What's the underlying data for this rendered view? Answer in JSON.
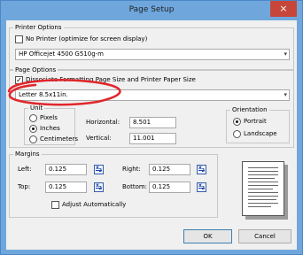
{
  "window": {
    "title": "Page Setup",
    "close_glyph": "×"
  },
  "printer_options": {
    "title": "Printer Options",
    "no_printer_label": "No Printer (optimize for screen display)",
    "no_printer_checked": false,
    "printer_selected": "HP Officejet 4500 G510g-m"
  },
  "page_options": {
    "title": "Page Options",
    "dissociate_label": "Dissociate Formatting Page Size and Printer Paper Size",
    "dissociate_checked": true,
    "page_size_selected": "Letter 8.5x11in."
  },
  "unit": {
    "title": "Unit",
    "options": [
      "Pixels",
      "Inches",
      "Centimeters"
    ],
    "selected": "Inches"
  },
  "size": {
    "horizontal_label": "Horizontal:",
    "horizontal_value": "8.501",
    "vertical_label": "Vertical:",
    "vertical_value": "11.001"
  },
  "orientation": {
    "title": "Orientation",
    "options": [
      "Portrait",
      "Landscape"
    ],
    "selected": "Portrait"
  },
  "margins": {
    "title": "Margins",
    "left_label": "Left:",
    "left_value": "0.125",
    "right_label": "Right:",
    "right_value": "0.125",
    "top_label": "Top:",
    "top_value": "0.125",
    "bottom_label": "Bottom:",
    "bottom_value": "0.125",
    "calc_x": "x",
    "calc_n": "2",
    "adjust_label": "Adjust Automatically",
    "adjust_checked": false
  },
  "buttons": {
    "ok": "OK",
    "cancel": "Cancel"
  },
  "colors": {
    "titlebar": "#6fa7dc",
    "close": "#c7463a",
    "annotation": "#e0262b"
  },
  "icons": {
    "calc": "x-over-2-icon",
    "preview": "page-preview-icon"
  }
}
